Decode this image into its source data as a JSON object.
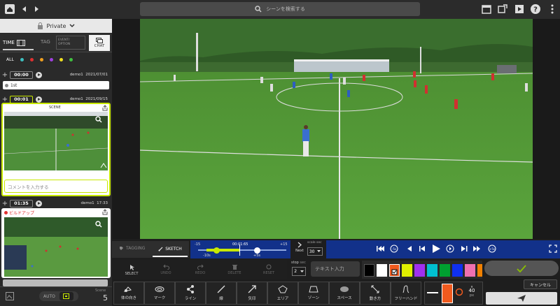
{
  "search": {
    "placeholder": "シーンを検索する"
  },
  "privacy": {
    "label": "Private"
  },
  "tabs": {
    "time": "TIME",
    "tag": "TAG",
    "event_option_1": "EVENT/",
    "event_option_2": "OPTION",
    "chat": "CHAT"
  },
  "filter": {
    "all": "ALL",
    "colors": [
      "#3ec0c0",
      "#e03030",
      "#f0a020",
      "#a040e0",
      "#f0e020",
      "#40c040"
    ]
  },
  "timeline": [
    {
      "time": "00:00",
      "user": "demo1",
      "date": "2021/07/01",
      "tag": "1st",
      "tag_color": "#888888"
    },
    {
      "time": "00:01",
      "user": "demo1",
      "date": "2021/09/15",
      "scene_label": "SCENE",
      "comment_placeholder": "コメントを入力する"
    },
    {
      "time": "01:35",
      "user": "demo1",
      "date": "17:33",
      "tag": "ビルドアップ",
      "tag_color": "#e03030"
    }
  ],
  "left_footer": {
    "auto": "AUTO",
    "scene_label": "Scene",
    "scene_count": "5"
  },
  "mode_tabs": {
    "tagging": "TAGGING",
    "sketch": "SKETCH"
  },
  "scrubber": {
    "left": "-15",
    "right": "+15",
    "current": "00:01:65",
    "minus": "-10s",
    "plus": "+5s",
    "next": "Next"
  },
  "scale": {
    "label": "scale",
    "unit": "sec",
    "value": "30"
  },
  "sketch_tools": {
    "select": "SELECT",
    "undo": "UNDO",
    "redo": "REDO",
    "delete": "DELETE",
    "reset": "RESET"
  },
  "stop": {
    "label": "stop",
    "unit": "sec",
    "value": "2"
  },
  "text_input": {
    "placeholder": "テキスト入力"
  },
  "swatches": [
    "#000000",
    "#ffffff",
    "#f05a1e",
    "#e0f000",
    "#a030f0",
    "#00c0d0",
    "#00a030",
    "#1030f0",
    "#f070b0",
    "#f08000"
  ],
  "draw_tools": [
    "体の向き",
    "マーク",
    "ライン",
    "線",
    "矢印",
    "エリア",
    "ゾーン",
    "スペース",
    "動き方",
    "フリーハンド"
  ],
  "stroke": {
    "size_label": "40",
    "size_unit": "px"
  },
  "actions": {
    "cancel": "キャンセル"
  },
  "playback": {
    "rewind_label": "-5s",
    "forward_label": "+5s",
    "skip_label": "+30s"
  }
}
